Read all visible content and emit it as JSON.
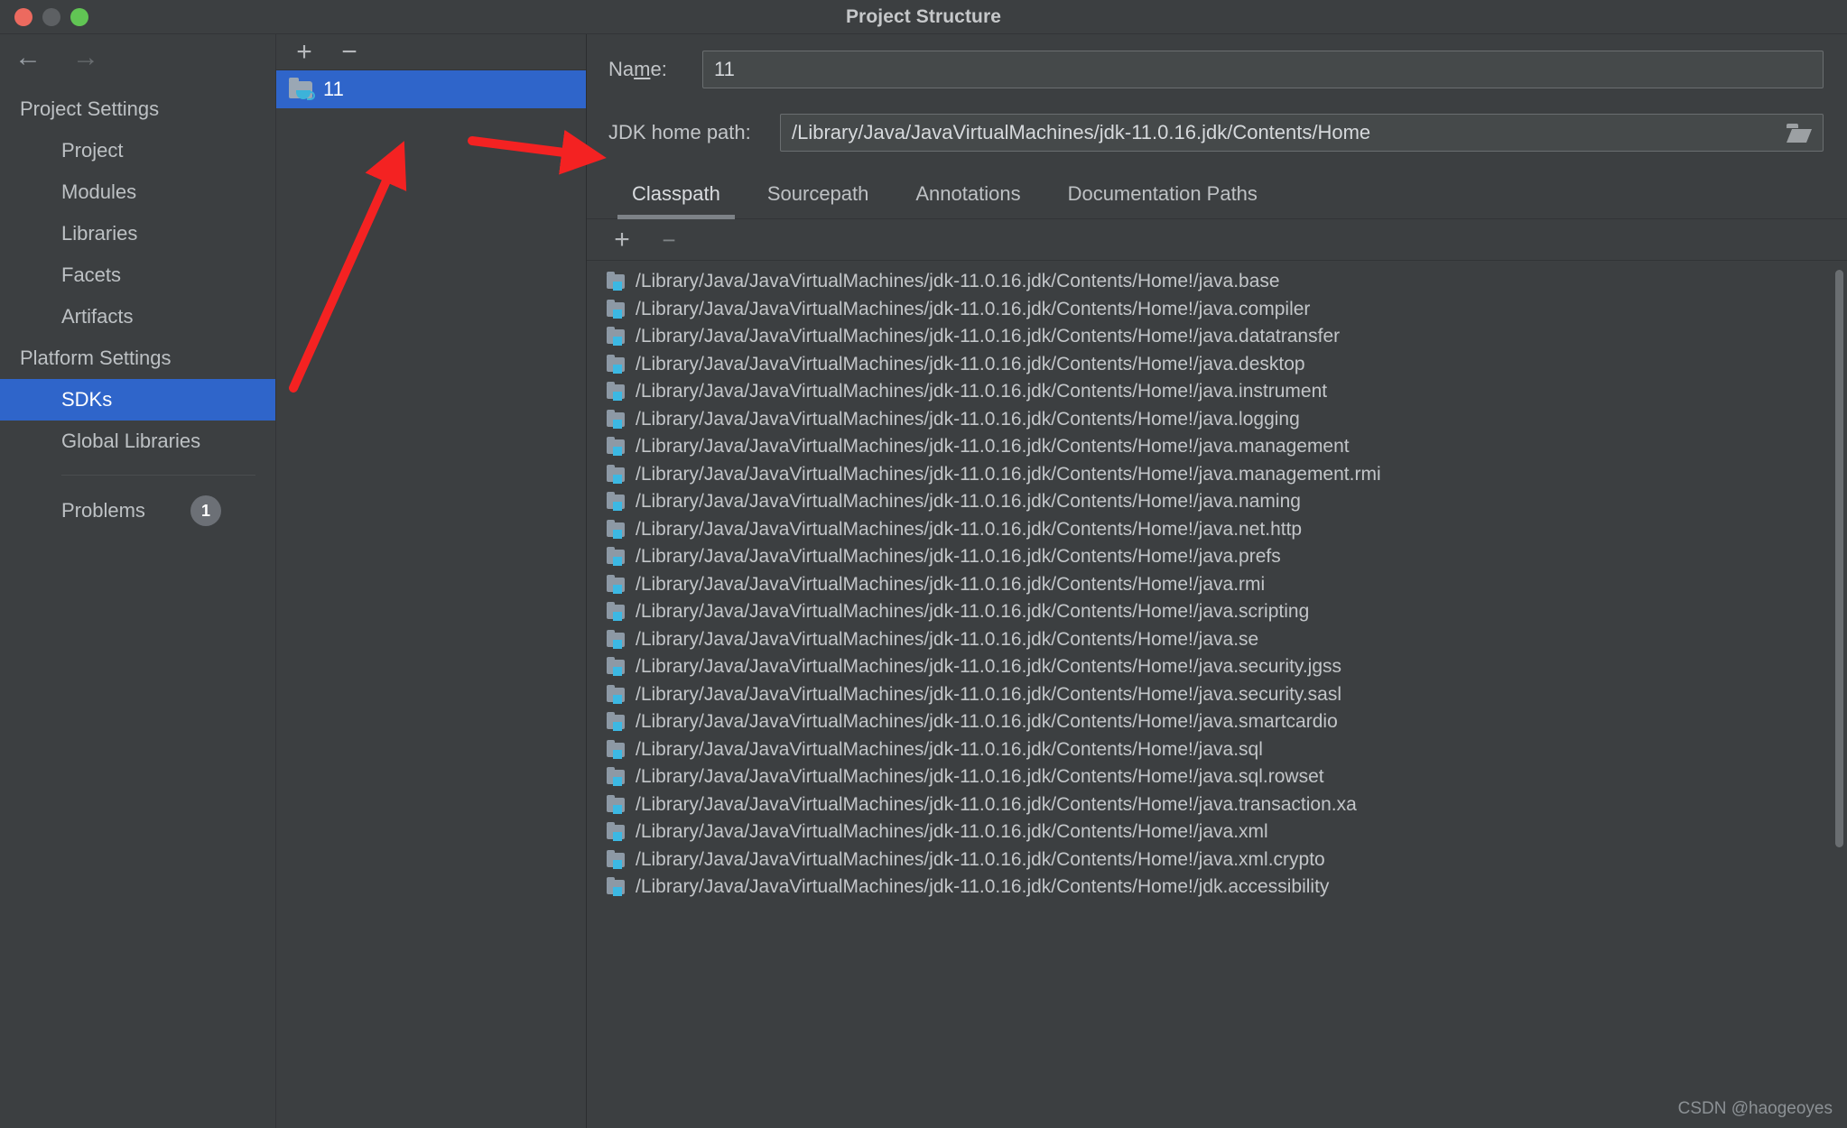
{
  "window": {
    "title": "Project Structure",
    "traffic_lights": [
      "close-button",
      "minimize-button",
      "maximize-button"
    ]
  },
  "navigation": {
    "back_icon": "arrow-left-icon",
    "forward_icon": "arrow-right-icon"
  },
  "sidebar": {
    "groups": [
      {
        "title": "Project Settings",
        "items": [
          {
            "label": "Project",
            "selected": false
          },
          {
            "label": "Modules",
            "selected": false
          },
          {
            "label": "Libraries",
            "selected": false
          },
          {
            "label": "Facets",
            "selected": false
          },
          {
            "label": "Artifacts",
            "selected": false
          }
        ]
      },
      {
        "title": "Platform Settings",
        "items": [
          {
            "label": "SDKs",
            "selected": true
          },
          {
            "label": "Global Libraries",
            "selected": false
          }
        ]
      }
    ],
    "problems": {
      "label": "Problems",
      "count": "1"
    }
  },
  "sdk_panel": {
    "toolbar": {
      "add_label": "+",
      "remove_label": "−"
    },
    "items": [
      {
        "label": "11",
        "icon": "jdk-folder-icon",
        "selected": true
      }
    ]
  },
  "detail": {
    "name": {
      "label_before": "Na",
      "label_mnemonic": "m",
      "label_after": "e:",
      "value": "11"
    },
    "jdk_home_path": {
      "label": "JDK home path:",
      "value": "/Library/Java/JavaVirtualMachines/jdk-11.0.16.jdk/Contents/Home",
      "browse_icon": "folder-open-icon"
    },
    "tabs": [
      {
        "label": "Classpath",
        "active": true
      },
      {
        "label": "Sourcepath",
        "active": false
      },
      {
        "label": "Annotations",
        "active": false
      },
      {
        "label": "Documentation Paths",
        "active": false
      }
    ],
    "classpath_toolbar": {
      "add_label": "+",
      "remove_label": "−"
    },
    "classpath_entries": [
      "/Library/Java/JavaVirtualMachines/jdk-11.0.16.jdk/Contents/Home!/java.base",
      "/Library/Java/JavaVirtualMachines/jdk-11.0.16.jdk/Contents/Home!/java.compiler",
      "/Library/Java/JavaVirtualMachines/jdk-11.0.16.jdk/Contents/Home!/java.datatransfer",
      "/Library/Java/JavaVirtualMachines/jdk-11.0.16.jdk/Contents/Home!/java.desktop",
      "/Library/Java/JavaVirtualMachines/jdk-11.0.16.jdk/Contents/Home!/java.instrument",
      "/Library/Java/JavaVirtualMachines/jdk-11.0.16.jdk/Contents/Home!/java.logging",
      "/Library/Java/JavaVirtualMachines/jdk-11.0.16.jdk/Contents/Home!/java.management",
      "/Library/Java/JavaVirtualMachines/jdk-11.0.16.jdk/Contents/Home!/java.management.rmi",
      "/Library/Java/JavaVirtualMachines/jdk-11.0.16.jdk/Contents/Home!/java.naming",
      "/Library/Java/JavaVirtualMachines/jdk-11.0.16.jdk/Contents/Home!/java.net.http",
      "/Library/Java/JavaVirtualMachines/jdk-11.0.16.jdk/Contents/Home!/java.prefs",
      "/Library/Java/JavaVirtualMachines/jdk-11.0.16.jdk/Contents/Home!/java.rmi",
      "/Library/Java/JavaVirtualMachines/jdk-11.0.16.jdk/Contents/Home!/java.scripting",
      "/Library/Java/JavaVirtualMachines/jdk-11.0.16.jdk/Contents/Home!/java.se",
      "/Library/Java/JavaVirtualMachines/jdk-11.0.16.jdk/Contents/Home!/java.security.jgss",
      "/Library/Java/JavaVirtualMachines/jdk-11.0.16.jdk/Contents/Home!/java.security.sasl",
      "/Library/Java/JavaVirtualMachines/jdk-11.0.16.jdk/Contents/Home!/java.smartcardio",
      "/Library/Java/JavaVirtualMachines/jdk-11.0.16.jdk/Contents/Home!/java.sql",
      "/Library/Java/JavaVirtualMachines/jdk-11.0.16.jdk/Contents/Home!/java.sql.rowset",
      "/Library/Java/JavaVirtualMachines/jdk-11.0.16.jdk/Contents/Home!/java.transaction.xa",
      "/Library/Java/JavaVirtualMachines/jdk-11.0.16.jdk/Contents/Home!/java.xml",
      "/Library/Java/JavaVirtualMachines/jdk-11.0.16.jdk/Contents/Home!/java.xml.crypto",
      "/Library/Java/JavaVirtualMachines/jdk-11.0.16.jdk/Contents/Home!/jdk.accessibility"
    ]
  },
  "annotations": {
    "accent_color": "#f42222",
    "arrows": [
      {
        "name": "arrow-to-sdk-item",
        "direction": "up-right"
      },
      {
        "name": "arrow-to-jdk-home-path",
        "direction": "right"
      }
    ]
  },
  "watermark": {
    "text": "CSDN @haogeoyes"
  },
  "colors": {
    "window_background": "#3c3f41",
    "selection_blue": "#2f65ca",
    "text_primary": "#bdc1c4",
    "annotation_red": "#f42222",
    "module_icon_accent": "#3cb8e3"
  }
}
